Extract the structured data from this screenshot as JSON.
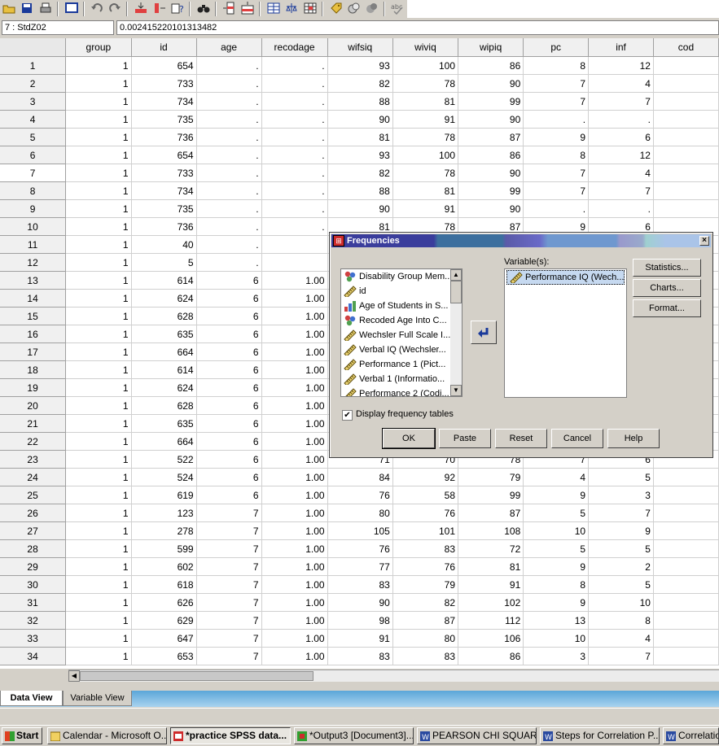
{
  "cell_bar": {
    "cell_reference": "7 : StdZ02",
    "cell_value": "0.00241522010131348​2"
  },
  "grid": {
    "columns": [
      "group",
      "id",
      "age",
      "recodage",
      "wifsiq",
      "wiviq",
      "wipiq",
      "pc",
      "inf",
      "cod"
    ],
    "rows": [
      [
        "1",
        "1",
        "654",
        ".",
        ".",
        "93",
        "100",
        "86",
        "8",
        "12",
        ""
      ],
      [
        "2",
        "1",
        "733",
        ".",
        ".",
        "82",
        "78",
        "90",
        "7",
        "4",
        ""
      ],
      [
        "3",
        "1",
        "734",
        ".",
        ".",
        "88",
        "81",
        "99",
        "7",
        "7",
        ""
      ],
      [
        "4",
        "1",
        "735",
        ".",
        ".",
        "90",
        "91",
        "90",
        ".",
        ".",
        ""
      ],
      [
        "5",
        "1",
        "736",
        ".",
        ".",
        "81",
        "78",
        "87",
        "9",
        "6",
        ""
      ],
      [
        "6",
        "1",
        "654",
        ".",
        ".",
        "93",
        "100",
        "86",
        "8",
        "12",
        ""
      ],
      [
        "7",
        "1",
        "733",
        ".",
        ".",
        "82",
        "78",
        "90",
        "7",
        "4",
        ""
      ],
      [
        "8",
        "1",
        "734",
        ".",
        ".",
        "88",
        "81",
        "99",
        "7",
        "7",
        ""
      ],
      [
        "9",
        "1",
        "735",
        ".",
        ".",
        "90",
        "91",
        "90",
        ".",
        ".",
        ""
      ],
      [
        "10",
        "1",
        "736",
        ".",
        ".",
        "81",
        "78",
        "87",
        "9",
        "6",
        ""
      ],
      [
        "11",
        "1",
        "40",
        ".",
        "",
        "",
        "",
        "",
        "",
        "",
        ""
      ],
      [
        "12",
        "1",
        "5",
        ".",
        "",
        "",
        "",
        "",
        "",
        "",
        ""
      ],
      [
        "13",
        "1",
        "614",
        "6",
        "1.00",
        "",
        "",
        "",
        "",
        "",
        ""
      ],
      [
        "14",
        "1",
        "624",
        "6",
        "1.00",
        "",
        "",
        "",
        "",
        "",
        ""
      ],
      [
        "15",
        "1",
        "628",
        "6",
        "1.00",
        "",
        "",
        "",
        "",
        "",
        ""
      ],
      [
        "16",
        "1",
        "635",
        "6",
        "1.00",
        "",
        "",
        "",
        "",
        "",
        ""
      ],
      [
        "17",
        "1",
        "664",
        "6",
        "1.00",
        "",
        "",
        "",
        "",
        "",
        ""
      ],
      [
        "18",
        "1",
        "614",
        "6",
        "1.00",
        "",
        "",
        "",
        "",
        "",
        ""
      ],
      [
        "19",
        "1",
        "624",
        "6",
        "1.00",
        "",
        "",
        "",
        "",
        "",
        ""
      ],
      [
        "20",
        "1",
        "628",
        "6",
        "1.00",
        "",
        "",
        "",
        "",
        "",
        ""
      ],
      [
        "21",
        "1",
        "635",
        "6",
        "1.00",
        "",
        "",
        "",
        "",
        "",
        ""
      ],
      [
        "22",
        "1",
        "664",
        "6",
        "1.00",
        "",
        "",
        "",
        "",
        "",
        ""
      ],
      [
        "23",
        "1",
        "522",
        "6",
        "1.00",
        "71",
        "70",
        "78",
        "7",
        "6",
        ""
      ],
      [
        "24",
        "1",
        "524",
        "6",
        "1.00",
        "84",
        "92",
        "79",
        "4",
        "5",
        ""
      ],
      [
        "25",
        "1",
        "619",
        "6",
        "1.00",
        "76",
        "58",
        "99",
        "9",
        "3",
        ""
      ],
      [
        "26",
        "1",
        "123",
        "7",
        "1.00",
        "80",
        "76",
        "87",
        "5",
        "7",
        ""
      ],
      [
        "27",
        "1",
        "278",
        "7",
        "1.00",
        "105",
        "101",
        "108",
        "10",
        "9",
        ""
      ],
      [
        "28",
        "1",
        "599",
        "7",
        "1.00",
        "76",
        "83",
        "72",
        "5",
        "5",
        ""
      ],
      [
        "29",
        "1",
        "602",
        "7",
        "1.00",
        "77",
        "76",
        "81",
        "9",
        "2",
        ""
      ],
      [
        "30",
        "1",
        "618",
        "7",
        "1.00",
        "83",
        "79",
        "91",
        "8",
        "5",
        ""
      ],
      [
        "31",
        "1",
        "626",
        "7",
        "1.00",
        "90",
        "82",
        "102",
        "9",
        "10",
        ""
      ],
      [
        "32",
        "1",
        "629",
        "7",
        "1.00",
        "98",
        "87",
        "112",
        "13",
        "8",
        ""
      ],
      [
        "33",
        "1",
        "647",
        "7",
        "1.00",
        "91",
        "80",
        "106",
        "10",
        "4",
        ""
      ],
      [
        "34",
        "1",
        "653",
        "7",
        "1.00",
        "83",
        "83",
        "86",
        "3",
        "7",
        ""
      ]
    ]
  },
  "view_tabs": {
    "data_view": "Data View",
    "variable_view": "Variable View"
  },
  "dialog": {
    "title": "Frequencies",
    "close_glyph": "×",
    "source_variables": [
      {
        "label": "Disability Group Mem...",
        "icon": "nominal-icon"
      },
      {
        "label": "id",
        "icon": "scale-icon"
      },
      {
        "label": "Age of Students in S...",
        "icon": "ordinal-icon"
      },
      {
        "label": "Recoded Age Into C...",
        "icon": "nominal-icon"
      },
      {
        "label": "Wechsler Full Scale I...",
        "icon": "scale-icon"
      },
      {
        "label": "Verbal IQ (Wechsler...",
        "icon": "scale-icon"
      },
      {
        "label": "Performance 1 (Pict...",
        "icon": "scale-icon"
      },
      {
        "label": "Verbal 1 (Informatio...",
        "icon": "scale-icon"
      },
      {
        "label": "Performance 2 (Codi...",
        "icon": "scale-icon"
      }
    ],
    "variables_label": "Variable(s):",
    "selected_variables": [
      {
        "label": "Performance IQ (Wech...",
        "icon": "scale-icon"
      }
    ],
    "statistics_button": "Statistics...",
    "charts_button": "Charts...",
    "format_button": "Format...",
    "display_frequency_tables_label": "Display frequency tables",
    "display_frequency_tables_checked": true,
    "ok_button": "OK",
    "paste_button": "Paste",
    "reset_button": "Reset",
    "cancel_button": "Cancel",
    "help_button": "Help"
  },
  "taskbar": {
    "start_label": "Start",
    "items": [
      {
        "label": "Calendar - Microsoft O...",
        "active": false
      },
      {
        "label": "*practice SPSS data...",
        "active": true
      },
      {
        "label": "*Output3 [Document3]...",
        "active": false
      },
      {
        "label": "PEARSON CHI SQUARE...",
        "active": false
      },
      {
        "label": "Steps for Correlation P...",
        "active": false
      },
      {
        "label": "Correlation",
        "active": false
      }
    ]
  },
  "colors": {
    "title_bar": "#3a3d9c",
    "selection": "#c6d9f0",
    "view_tab_band": "#5aa6d8"
  }
}
